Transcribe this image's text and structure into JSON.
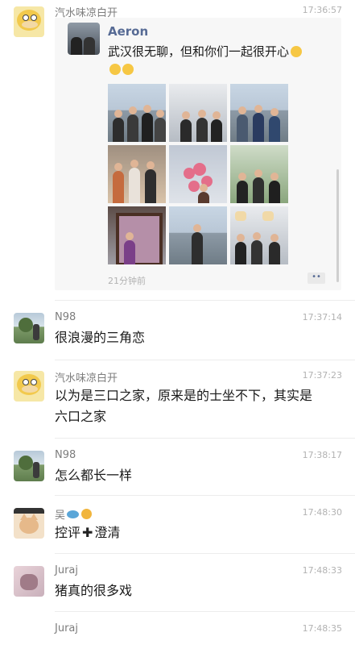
{
  "comments": [
    {
      "name": "汽水味凉白开",
      "time": "17:36:57",
      "moment": {
        "author": "Aeron",
        "text": "武汉很无聊，但和你们一起很开心",
        "posted": "21分钟前",
        "more_icon": "more-dots-icon"
      }
    },
    {
      "name": "N98",
      "time": "17:37:14",
      "text": "很浪漫的三角恋"
    },
    {
      "name": "汽水味凉白开",
      "time": "17:37:23",
      "text_line1": "以为是三口之家，原来是的士坐不下，其实是",
      "text_line2": "六口之家"
    },
    {
      "name": "N98",
      "time": "17:38:17",
      "text": "怎么都长一样"
    },
    {
      "name": "吴",
      "time": "17:48:30",
      "text_a": "控评",
      "text_b": "澄清"
    },
    {
      "name": "Juraj",
      "time": "17:48:33",
      "text": "猪真的很多戏"
    },
    {
      "name": "Juraj",
      "time": "17:48:35"
    }
  ],
  "colors": {
    "link": "#576b95",
    "meta": "#b2b2b2",
    "divider": "#ececec"
  }
}
